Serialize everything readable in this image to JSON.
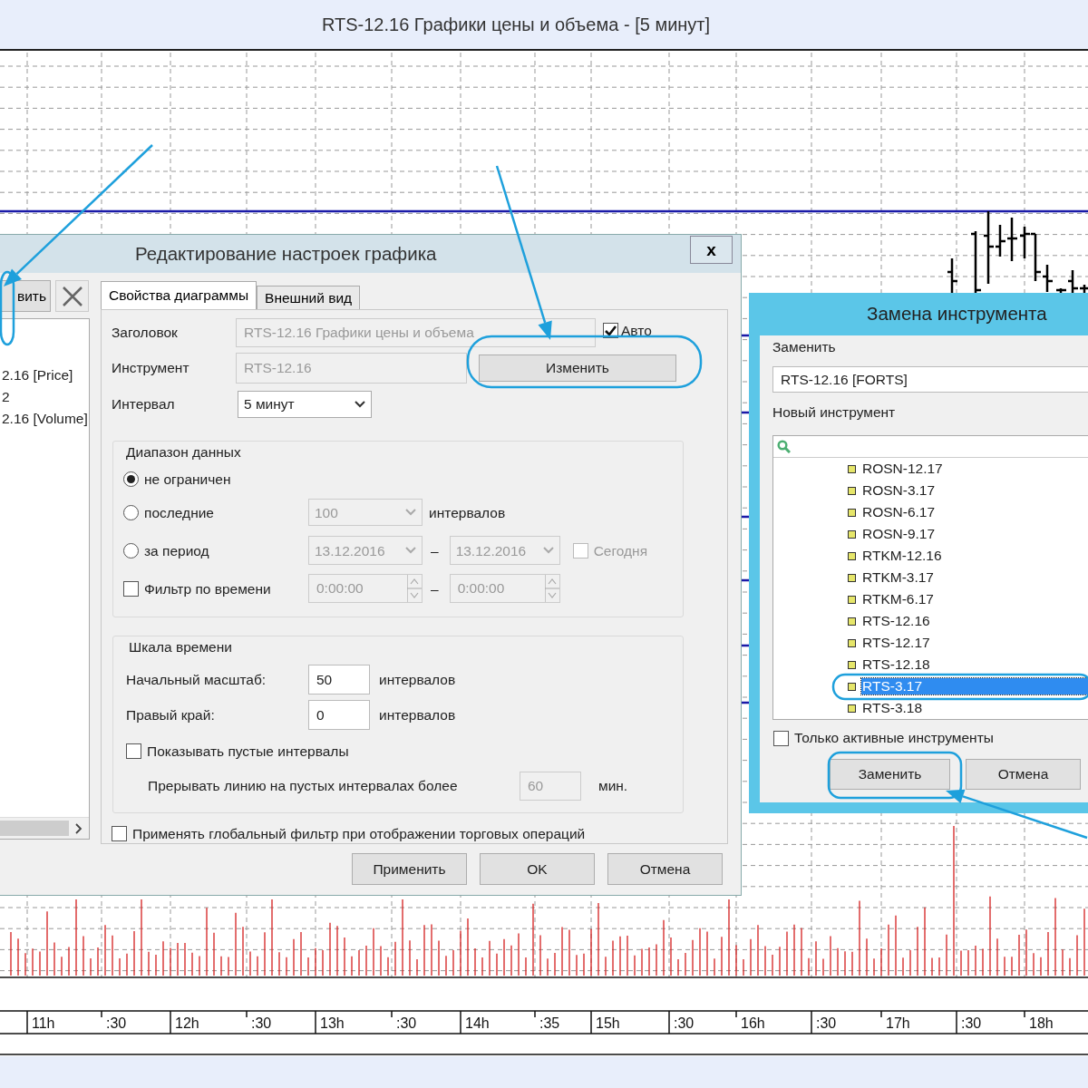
{
  "window": {
    "title": "RTS-12.16 Графики цены и объема - [5 минут]"
  },
  "time_axis": [
    "11h",
    ":30",
    "12h",
    ":30",
    "13h",
    ":30",
    "14h",
    ":35",
    "15h",
    ":30",
    "16h",
    ":30",
    "17h",
    ":30",
    "18h"
  ],
  "settings_dialog": {
    "title": "Редактирование настроек графика",
    "close": "x",
    "left_panel": {
      "button": "вить",
      "items": [
        "2.16 [Price]",
        "2",
        "2.16 [Volume]"
      ]
    },
    "tabs": [
      {
        "label": "Свойства диаграммы",
        "selected": true
      },
      {
        "label": "Внешний вид",
        "selected": false
      }
    ],
    "header": {
      "label": "Заголовок",
      "value": "RTS-12.16 Графики цены и объема",
      "auto": {
        "label": "Авто",
        "checked": true
      }
    },
    "instrument": {
      "label": "Инструмент",
      "value": "RTS-12.16",
      "disabled": true,
      "button": "Изменить"
    },
    "interval": {
      "label": "Интервал",
      "value": "5 минут"
    },
    "data_range": {
      "title": "Диапазон данных",
      "options": [
        {
          "kind": "plain",
          "label": "не ограничен",
          "selected": true
        },
        {
          "kind": "count",
          "label": "последние",
          "selected": false,
          "value": "100",
          "unit": "интервалов"
        },
        {
          "kind": "period",
          "label": "за период",
          "selected": false,
          "from": "13.12.2016",
          "dash": "–",
          "to": "13.12.2016",
          "today": {
            "label": "Сегодня",
            "checked": false
          }
        }
      ],
      "time_filter": {
        "label": "Фильтр по времени",
        "checked": false,
        "from": "0:00:00",
        "dash": "–",
        "to": "0:00:00"
      }
    },
    "time_scale": {
      "title": "Шкала времени",
      "rows": [
        {
          "label": "Начальный масштаб:",
          "value": "50",
          "unit": "интервалов"
        },
        {
          "label": "Правый край:",
          "value": "0",
          "unit": "интервалов"
        }
      ],
      "show_empty": {
        "label": "Показывать пустые интервалы",
        "checked": false
      },
      "break_line": {
        "label": "Прерывать линию на пустых интервалах более",
        "value": "60",
        "unit": "мин."
      }
    },
    "global_filter": {
      "label": "Применять глобальный фильтр при отображении торговых операций",
      "checked": false
    },
    "buttons": [
      "Применить",
      "OK",
      "Отмена"
    ]
  },
  "replace_dialog": {
    "title": "Замена инструмента",
    "replace_label": "Заменить",
    "replace_value": "RTS-12.16 [FORTS]",
    "new_label": "Новый инструмент",
    "instruments": [
      {
        "label": "ROSN-12.17",
        "selected": false
      },
      {
        "label": "ROSN-3.17",
        "selected": false
      },
      {
        "label": "ROSN-6.17",
        "selected": false
      },
      {
        "label": "ROSN-9.17",
        "selected": false
      },
      {
        "label": "RTKM-12.16",
        "selected": false
      },
      {
        "label": "RTKM-3.17",
        "selected": false
      },
      {
        "label": "RTKM-6.17",
        "selected": false
      },
      {
        "label": "RTS-12.16",
        "selected": false
      },
      {
        "label": "RTS-12.17",
        "selected": false
      },
      {
        "label": "RTS-12.18",
        "selected": false
      },
      {
        "label": "RTS-3.17",
        "selected": true
      },
      {
        "label": "RTS-3.18",
        "selected": false
      }
    ],
    "active_only": {
      "label": "Только активные инструменты",
      "checked": false
    },
    "buttons": [
      "Заменить",
      "Отмена"
    ]
  }
}
